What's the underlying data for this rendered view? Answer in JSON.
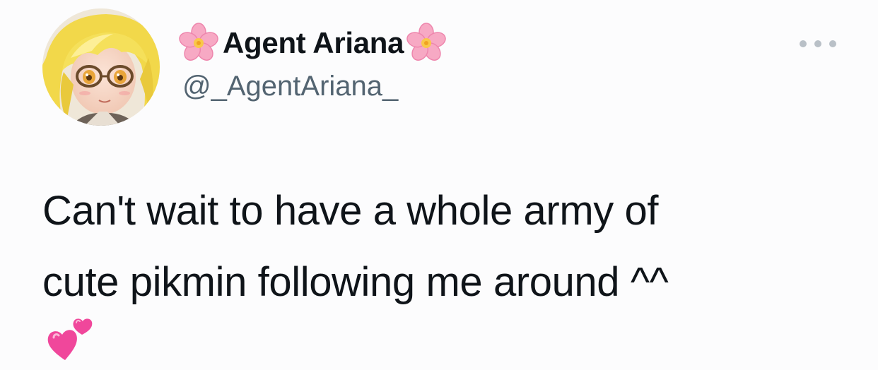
{
  "author": {
    "display_name": "Agent Ariana",
    "handle": "@_AgentAriana_",
    "name_prefix_icon": "cherry-blossom-icon",
    "name_suffix_icon": "cherry-blossom-icon",
    "avatar_icon": "avatar-anime-girl-with-glasses"
  },
  "tweet": {
    "text_line_1": "Can't wait to have a whole army of",
    "text_line_2": "cute pikmin following me around ^^",
    "trailing_emoji": "revolving-hearts-icon"
  },
  "menu": {
    "more_icon": "more-options-icon"
  },
  "colors": {
    "background": "#fcfcfd",
    "text": "#0f1419",
    "secondary_text": "#536471",
    "more_dots": "#b9c0c7",
    "flower_pink": "#f7a9c4",
    "heart_pink": "#f0479b"
  }
}
